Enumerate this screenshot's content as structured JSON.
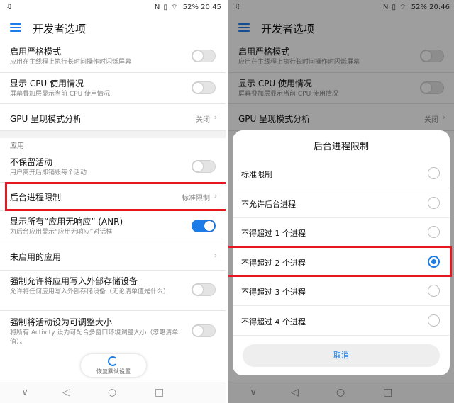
{
  "left": {
    "status": {
      "left_icon": "♫",
      "icons": "N ▯ ⌔",
      "battery": "52%",
      "time": "20:45"
    },
    "title": "开发者选项",
    "strict_mode": {
      "title": "启用严格模式",
      "subtitle": "应用在主线程上执行长时间操作时闪烁屏幕"
    },
    "cpu_usage": {
      "title": "显示 CPU 使用情况",
      "subtitle": "屏幕叠加层显示当前 CPU 使用情况"
    },
    "gpu": {
      "title": "GPU 呈现模式分析",
      "value": "关闭"
    },
    "section_apps": "应用",
    "dont_keep": {
      "title": "不保留活动",
      "subtitle": "用户离开后即销毁每个活动"
    },
    "bg_limit": {
      "title": "后台进程限制",
      "value": "标准限制"
    },
    "anr": {
      "title": "显示所有“应用无响应” (ANR)",
      "subtitle": "为后台应用显示“应用无响应”对话框"
    },
    "inactive_apps": {
      "title": "未启用的应用"
    },
    "force_external": {
      "title": "强制允许将应用写入外部存储设备",
      "subtitle": "允许将任何应用写入外部存储设备（无论清单值是什么）"
    },
    "resizable": {
      "title": "强制将活动设为可调整大小",
      "subtitle": "将所有 Activity 设为可配合多窗口环境调整大小（忽略清单值）。"
    },
    "restore_label": "恢复默认设置",
    "nav": {
      "back": "◁",
      "home": "○",
      "recent": "□",
      "down": "∨"
    }
  },
  "right": {
    "status": {
      "left_icon": "♫",
      "icons": "N ▯ ⌔",
      "battery": "52%",
      "time": "20:46"
    },
    "title": "开发者选项",
    "strict_mode": {
      "title": "启用严格模式",
      "subtitle": "应用在主线程上执行长时间操作时闪烁屏幕"
    },
    "cpu_usage": {
      "title": "显示 CPU 使用情况",
      "subtitle": "屏幕叠加层显示当前 CPU 使用情况"
    },
    "gpu": {
      "title": "GPU 呈现模式分析",
      "value": "关闭"
    },
    "dialog": {
      "title": "后台进程限制",
      "options": [
        {
          "label": "标准限制",
          "selected": false
        },
        {
          "label": "不允许后台进程",
          "selected": false
        },
        {
          "label": "不得超过 1 个进程",
          "selected": false
        },
        {
          "label": "不得超过 2 个进程",
          "selected": true
        },
        {
          "label": "不得超过 3 个进程",
          "selected": false
        },
        {
          "label": "不得超过 4 个进程",
          "selected": false
        }
      ],
      "cancel": "取消"
    },
    "nav": {
      "back": "◁",
      "home": "○",
      "recent": "□",
      "down": "∨"
    }
  },
  "colors": {
    "accent": "#1d7de8",
    "highlight": "#e8161f"
  },
  "icons": {
    "menu": "menu-icon",
    "chevron": "chevron-right-icon",
    "restore": "restore-icon",
    "radio_on": "radio-selected-icon",
    "radio_off": "radio-unselected-icon"
  },
  "toggles": {
    "strict_mode": false,
    "cpu_usage": false,
    "dont_keep": false,
    "anr": true,
    "force_external": false,
    "resizable": false
  }
}
